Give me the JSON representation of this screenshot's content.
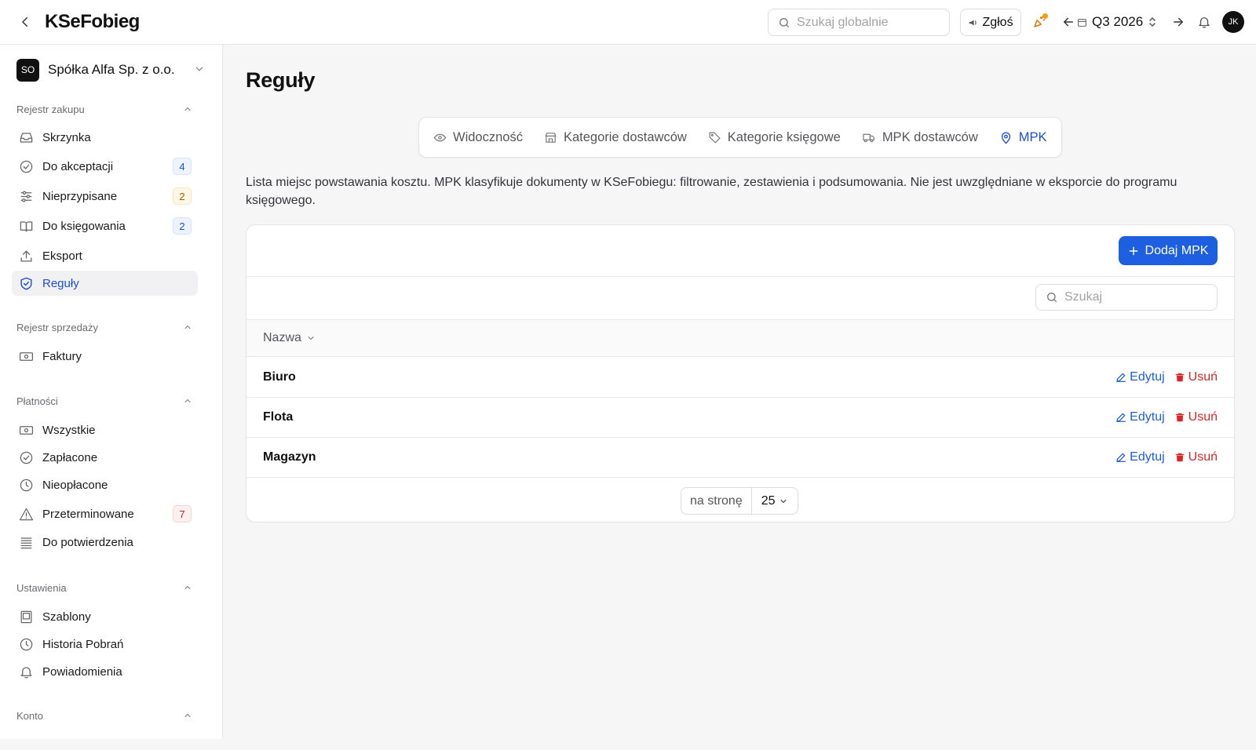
{
  "header": {
    "app_title": "KSeFobieg",
    "search_placeholder": "Szukaj globalnie",
    "report_label": "Zgłoś",
    "period_label": "Q3 2026",
    "avatar_initials": "JK"
  },
  "sidebar": {
    "company": {
      "initials": "SO",
      "name": "Spółka Alfa Sp. z o.o."
    },
    "sections": [
      {
        "title": "Rejestr zakupu",
        "items": [
          {
            "label": "Skrzynka",
            "icon": "inbox-icon"
          },
          {
            "label": "Do akceptacji",
            "icon": "check-circle-icon",
            "badge": "4",
            "badge_color": "blue"
          },
          {
            "label": "Nieprzypisane",
            "icon": "sliders-icon",
            "badge": "2",
            "badge_color": "amber"
          },
          {
            "label": "Do księgowania",
            "icon": "book-icon",
            "badge": "2",
            "badge_color": "blue"
          },
          {
            "label": "Eksport",
            "icon": "upload-icon"
          },
          {
            "label": "Reguły",
            "icon": "shield-check-icon",
            "active": true
          }
        ]
      },
      {
        "title": "Rejestr sprzedaży",
        "items": [
          {
            "label": "Faktury",
            "icon": "banknote-icon"
          }
        ]
      },
      {
        "title": "Płatności",
        "items": [
          {
            "label": "Wszystkie",
            "icon": "banknote-icon"
          },
          {
            "label": "Zapłacone",
            "icon": "check-circle-icon"
          },
          {
            "label": "Nieopłacone",
            "icon": "clock-icon"
          },
          {
            "label": "Przeterminowane",
            "icon": "warning-icon",
            "badge": "7",
            "badge_color": "red"
          },
          {
            "label": "Do potwierdzenia",
            "icon": "list-icon"
          }
        ]
      },
      {
        "title": "Ustawienia",
        "items": [
          {
            "label": "Szablony",
            "icon": "template-icon"
          },
          {
            "label": "Historia Pobrań",
            "icon": "clock-icon"
          },
          {
            "label": "Powiadomienia",
            "icon": "bell-icon"
          }
        ]
      },
      {
        "title": "Konto",
        "items": []
      }
    ]
  },
  "main": {
    "title": "Reguły",
    "tabs": [
      {
        "label": "Widoczność",
        "icon": "eye-icon"
      },
      {
        "label": "Kategorie dostawców",
        "icon": "store-icon"
      },
      {
        "label": "Kategorie księgowe",
        "icon": "tag-icon"
      },
      {
        "label": "MPK dostawców",
        "icon": "truck-icon"
      },
      {
        "label": "MPK",
        "icon": "map-pin-icon",
        "active": true
      }
    ],
    "description": "Lista miejsc powstawania kosztu. MPK klasyfikuje dokumenty w KSeFobiegu: filtrowanie, zestawienia i podsumowania. Nie jest uwzględniane w eksporcie do programu księgowego.",
    "add_button": "Dodaj MPK",
    "search_placeholder": "Szukaj",
    "column_name": "Nazwa",
    "rows": [
      {
        "name": "Biuro"
      },
      {
        "name": "Flota"
      },
      {
        "name": "Magazyn"
      }
    ],
    "edit_label": "Edytuj",
    "delete_label": "Usuń",
    "per_page_label": "na stronę",
    "per_page_value": "25"
  },
  "colors": {
    "accent": "#1d5fe0",
    "danger": "#dc2626"
  }
}
